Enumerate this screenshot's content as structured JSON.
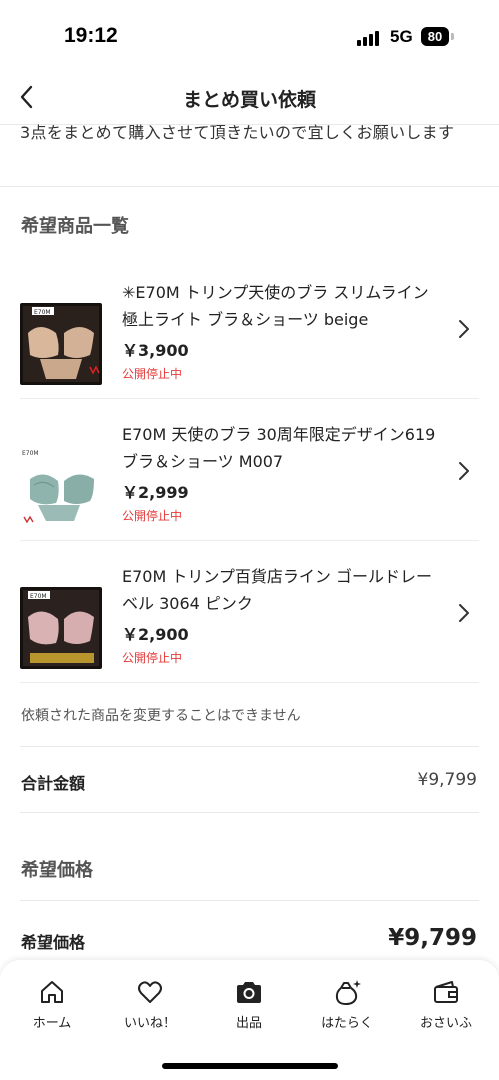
{
  "status_bar": {
    "time": "19:12",
    "network": "5G",
    "battery": "80"
  },
  "nav": {
    "title": "まとめ買い依頼"
  },
  "message": "3点をまとめて購入させて頂きたいので宜しくお願いします",
  "wishlist_heading": "希望商品一覧",
  "items": [
    {
      "title": "✳E70M トリンプ天使のブラ スリムライン極上ライト ブラ＆ショーツ beige",
      "price": "￥3,900",
      "status": "公開停止中"
    },
    {
      "title": "E70M 天使のブラ 30周年限定デザイン619 ブラ＆ショーツ M007",
      "price": "￥2,999",
      "status": "公開停止中"
    },
    {
      "title": "E70M トリンプ百貨店ライン ゴールドレーベル 3064 ピンク",
      "price": "￥2,900",
      "status": "公開停止中"
    }
  ],
  "notice": "依頼された商品を変更することはできません",
  "total": {
    "label": "合計金額",
    "value": "¥9,799"
  },
  "desired_price": {
    "heading": "希望価格",
    "label": "希望価格",
    "value": "¥9,799"
  },
  "tabbar": [
    {
      "label": "ホーム",
      "icon": "home-icon"
    },
    {
      "label": "いいね！",
      "icon": "heart-icon"
    },
    {
      "label": "出品",
      "icon": "camera-icon"
    },
    {
      "label": "はたらく",
      "icon": "bag-sparkle-icon"
    },
    {
      "label": "おさいふ",
      "icon": "wallet-icon"
    }
  ],
  "colors": {
    "status_red": "#e63a3a",
    "text": "#222222",
    "divider": "#ececec"
  }
}
